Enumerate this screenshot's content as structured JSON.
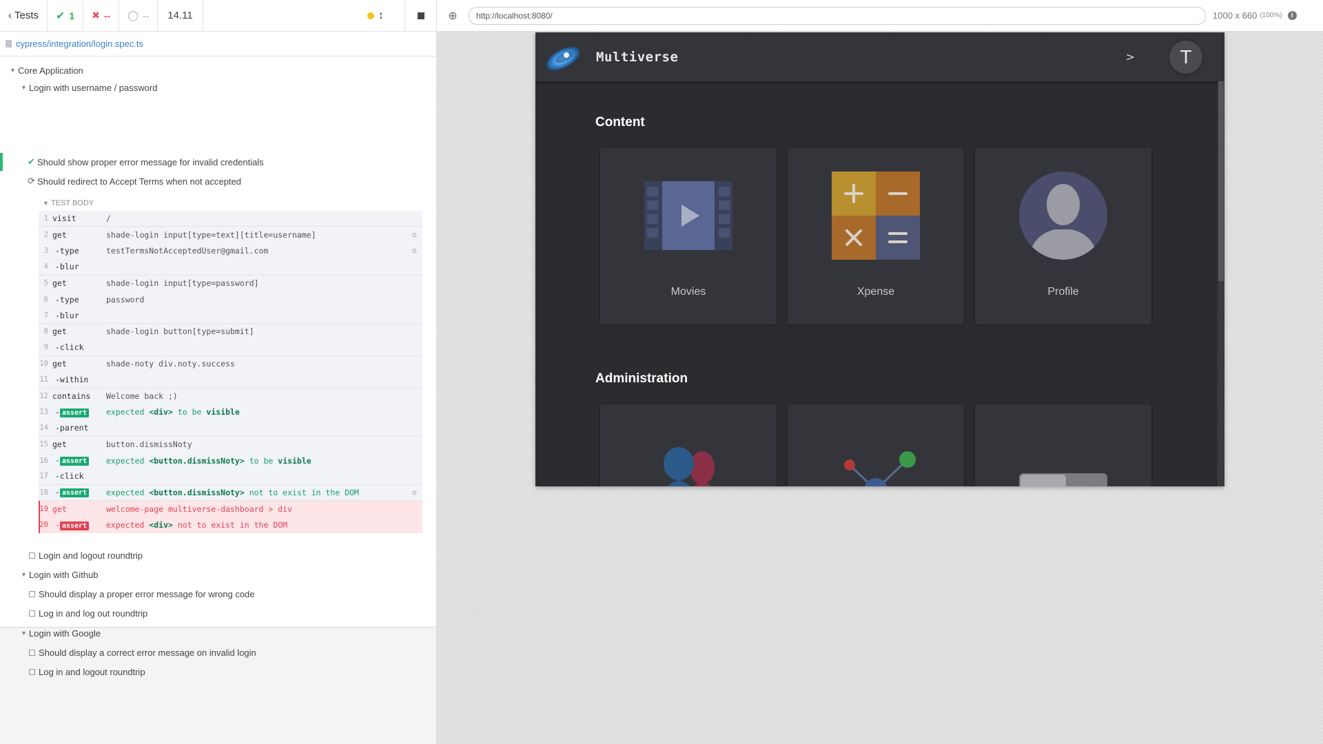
{
  "topbar": {
    "back_label": "Tests",
    "passed": "1",
    "failed": "--",
    "pending": "--",
    "duration": "14.11"
  },
  "spec": {
    "path": "cypress/integration/login.spec.ts"
  },
  "suites": {
    "root": "Core Application",
    "login_pw": "Login with username / password",
    "test_pass": "Should show proper error message for invalid credentials",
    "test_running": "Should redirect to Accept Terms when not accepted",
    "test_body": "TEST BODY",
    "test_roundtrip": "Login and logout roundtrip",
    "login_github": "Login with Github",
    "gh_test1": "Should display a proper error message for wrong code",
    "gh_test2": "Log in and log out roundtrip",
    "login_google": "Login with Google",
    "g_test1": "Should display a correct error message on invalid login",
    "g_test2": "Log in and logout roundtrip"
  },
  "commands": [
    {
      "n": "1",
      "name": "visit",
      "msg": "/"
    },
    {
      "n": "2",
      "name": "get",
      "msg": "shade-login input[type=text][title=username]"
    },
    {
      "n": "3",
      "name": "-type",
      "msg": "testTermsNotAcceptedUser@gmail.com"
    },
    {
      "n": "4",
      "name": "-blur",
      "msg": ""
    },
    {
      "n": "5",
      "name": "get",
      "msg": "shade-login input[type=password]"
    },
    {
      "n": "6",
      "name": "-type",
      "msg": "password"
    },
    {
      "n": "7",
      "name": "-blur",
      "msg": ""
    },
    {
      "n": "8",
      "name": "get",
      "msg": "shade-login button[type=submit]"
    },
    {
      "n": "9",
      "name": "-click",
      "msg": ""
    },
    {
      "n": "10",
      "name": "get",
      "msg": "shade-noty div.noty.success"
    },
    {
      "n": "11",
      "name": "-within",
      "msg": ""
    },
    {
      "n": "12",
      "name": "contains",
      "msg": "Welcome back ;)"
    },
    {
      "n": "13",
      "name": "-",
      "badge": "assert",
      "msg_parts": [
        "expected ",
        "<div>",
        " to be ",
        "visible"
      ]
    },
    {
      "n": "14",
      "name": "-parent",
      "msg": ""
    },
    {
      "n": "15",
      "name": "get",
      "msg": "button.dismissNoty"
    },
    {
      "n": "16",
      "name": "-",
      "badge": "assert",
      "msg_parts": [
        "expected ",
        "<button.dismissNoty>",
        " to be ",
        "visible"
      ]
    },
    {
      "n": "17",
      "name": "-click",
      "msg": ""
    },
    {
      "n": "18",
      "name": "-",
      "badge": "assert",
      "msg_parts": [
        "expected ",
        "<button.dismissNoty>",
        " not to exist in the DOM",
        ""
      ]
    },
    {
      "n": "19",
      "name": "get",
      "msg": "welcome-page multiverse-dashboard > div"
    },
    {
      "n": "20",
      "name": "-",
      "badge": "assert",
      "msg_parts": [
        "expected ",
        "<div>",
        " not to exist in the DOM",
        ""
      ]
    }
  ],
  "aut": {
    "url": "http://localhost:8080/",
    "viewport": "1000 x 660",
    "zoom": "(100%)"
  },
  "app": {
    "title": "Multiverse",
    "chevron": ">",
    "avatar_letter": "T",
    "sections": {
      "content": "Content",
      "admin": "Administration"
    },
    "cards": [
      "Movies",
      "Xpense",
      "Profile"
    ]
  },
  "colors": {
    "pass": "#2eb872",
    "fail": "#e14456",
    "accent": "#3b82c4"
  }
}
